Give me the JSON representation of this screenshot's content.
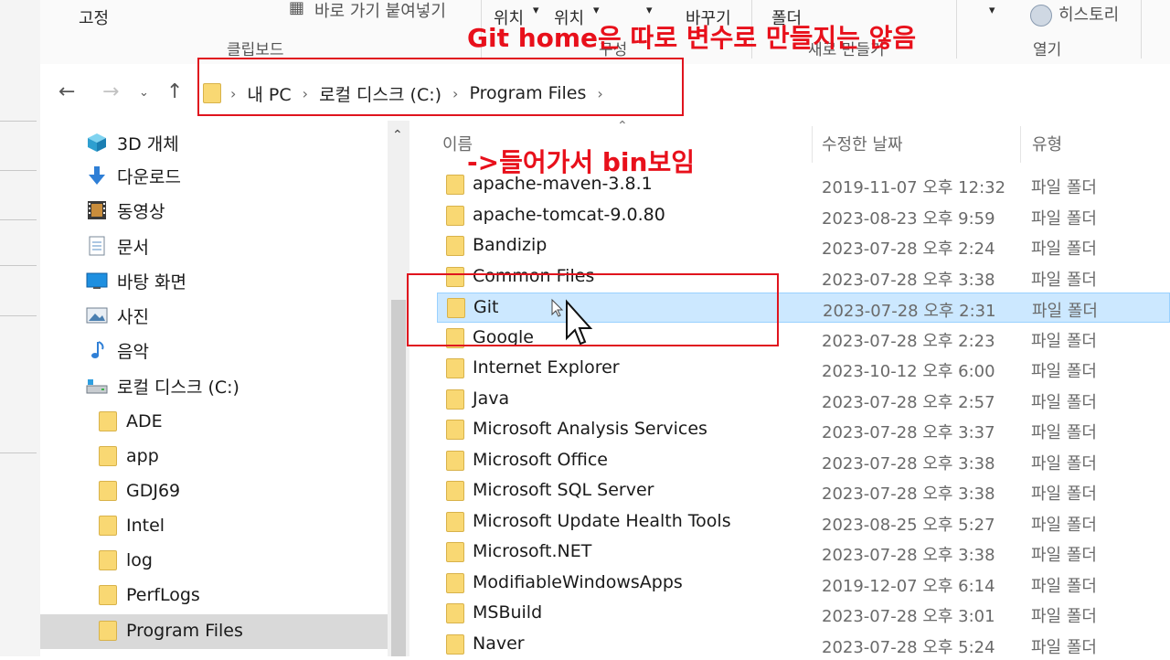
{
  "ribbon": {
    "top_fragments": [
      "고정",
      "바로 가기 붙여넣기",
      "위치",
      "위치",
      "바꾸기",
      "폴더",
      "히스토리"
    ],
    "clipboard_group": "클립보드",
    "organize_group": "구성",
    "new_group": "새로 만들기",
    "open_group": "열기"
  },
  "address": {
    "segments": [
      "내 PC",
      "로컬 디스크 (C:)",
      "Program Files"
    ]
  },
  "nav_pane": {
    "items": [
      {
        "label": "3D 개체",
        "icon": "cube-3d-icon"
      },
      {
        "label": "다운로드",
        "icon": "download-arrow-icon"
      },
      {
        "label": "동영상",
        "icon": "film-icon"
      },
      {
        "label": "문서",
        "icon": "document-icon"
      },
      {
        "label": "바탕 화면",
        "icon": "desktop-icon"
      },
      {
        "label": "사진",
        "icon": "picture-icon"
      },
      {
        "label": "음악",
        "icon": "music-note-icon"
      },
      {
        "label": "로컬 디스크 (C:)",
        "icon": "drive-icon"
      }
    ],
    "subfolders": [
      "ADE",
      "app",
      "GDJ69",
      "Intel",
      "log",
      "PerfLogs",
      "Program Files"
    ],
    "selected": "Program Files"
  },
  "columns": {
    "name": "이름",
    "date": "수정한 날짜",
    "type": "유형"
  },
  "files": [
    {
      "name": "apache-maven-3.8.1",
      "date": "2019-11-07 오후 12:32",
      "type": "파일 폴더"
    },
    {
      "name": "apache-tomcat-9.0.80",
      "date": "2023-08-23 오후 9:59",
      "type": "파일 폴더"
    },
    {
      "name": "Bandizip",
      "date": "2023-07-28 오후 2:24",
      "type": "파일 폴더"
    },
    {
      "name": "Common Files",
      "date": "2023-07-28 오후 3:38",
      "type": "파일 폴더"
    },
    {
      "name": "Git",
      "date": "2023-07-28 오후 2:31",
      "type": "파일 폴더"
    },
    {
      "name": "Google",
      "date": "2023-07-28 오후 2:23",
      "type": "파일 폴더"
    },
    {
      "name": "Internet Explorer",
      "date": "2023-10-12 오후 6:00",
      "type": "파일 폴더"
    },
    {
      "name": "Java",
      "date": "2023-07-28 오후 2:57",
      "type": "파일 폴더"
    },
    {
      "name": "Microsoft Analysis Services",
      "date": "2023-07-28 오후 3:37",
      "type": "파일 폴더"
    },
    {
      "name": "Microsoft Office",
      "date": "2023-07-28 오후 3:38",
      "type": "파일 폴더"
    },
    {
      "name": "Microsoft SQL Server",
      "date": "2023-07-28 오후 3:38",
      "type": "파일 폴더"
    },
    {
      "name": "Microsoft Update Health Tools",
      "date": "2023-08-25 오후 5:27",
      "type": "파일 폴더"
    },
    {
      "name": "Microsoft.NET",
      "date": "2023-07-28 오후 3:38",
      "type": "파일 폴더"
    },
    {
      "name": "ModifiableWindowsApps",
      "date": "2019-12-07 오후 6:14",
      "type": "파일 폴더"
    },
    {
      "name": "MSBuild",
      "date": "2023-07-28 오후 3:01",
      "type": "파일 폴더"
    },
    {
      "name": "Naver",
      "date": "2023-07-28 오후 5:24",
      "type": "파일 폴더"
    }
  ],
  "selected_file": "Git",
  "annotations": {
    "top_note": "Git home은 따로 변수로 만들지는 않음",
    "arrow_note": "->들어가서 bin보임"
  },
  "colors": {
    "annotation": "#e0141e",
    "selection": "#cce8ff",
    "folder": "#f9d873"
  }
}
